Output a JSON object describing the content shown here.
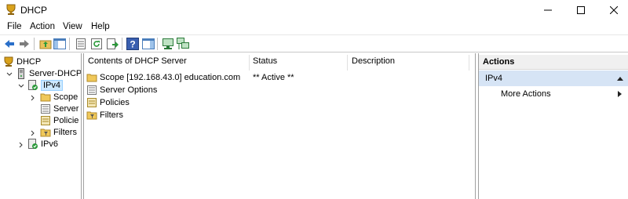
{
  "window": {
    "title": "DHCP"
  },
  "menu": [
    "File",
    "Action",
    "View",
    "Help"
  ],
  "toolbar": {
    "buttons": [
      "back-icon",
      "forward-icon",
      "up-folder-icon",
      "show-hide-tree-icon",
      "properties-icon",
      "refresh-icon",
      "export-list-icon",
      "help-icon",
      "show-hide-action-pane-icon",
      "server-status-icon",
      "network-icon"
    ]
  },
  "tree": {
    "root": "DHCP",
    "server": "Server-DHCP.e",
    "ipv4": "IPv4",
    "scope": "Scope",
    "server_options": "Server",
    "policies": "Policie",
    "filters": "Filters",
    "ipv6": "IPv6"
  },
  "content": {
    "columns": [
      "Contents of DHCP Server",
      "Status",
      "Description"
    ],
    "rows": [
      {
        "name": "Scope [192.168.43.0] education.com",
        "status": "** Active **",
        "description": ""
      },
      {
        "name": "Server Options",
        "status": "",
        "description": ""
      },
      {
        "name": "Policies",
        "status": "",
        "description": ""
      },
      {
        "name": "Filters",
        "status": "",
        "description": ""
      }
    ]
  },
  "actions": {
    "header": "Actions",
    "section": "IPv4",
    "items": [
      "More Actions"
    ]
  }
}
